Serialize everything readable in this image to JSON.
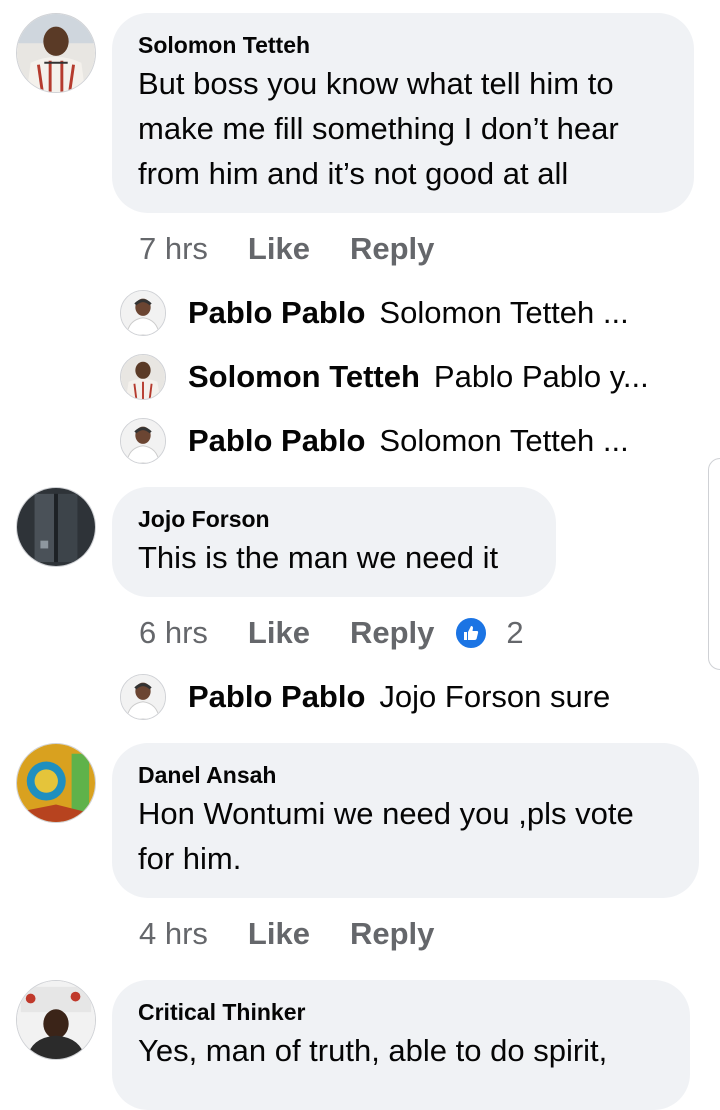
{
  "colors": {
    "bubble": "#f0f2f5",
    "meta_text": "#65676b",
    "like_badge": "#1b74e4"
  },
  "comments": [
    {
      "author": "Solomon Tetteh",
      "text": "But boss you know what tell him to\nmake me fill something I don’t hear\nfrom him and it’s not good at all",
      "time": "7 hrs",
      "like_label": "Like",
      "reply_label": "Reply",
      "replies": [
        {
          "author": "Pablo Pablo",
          "text": "Solomon Tetteh ..."
        },
        {
          "author": "Solomon Tetteh",
          "text": "Pablo Pablo y..."
        },
        {
          "author": "Pablo Pablo",
          "text": "Solomon Tetteh ..."
        }
      ]
    },
    {
      "author": "Jojo Forson",
      "text": "This is the man we need it",
      "time": "6 hrs",
      "like_label": "Like",
      "reply_label": "Reply",
      "reaction_icon": "thumbs-up-icon",
      "reaction_count": "2",
      "replies": [
        {
          "author": "Pablo Pablo",
          "text": "Jojo Forson sure"
        }
      ]
    },
    {
      "author": "Danel Ansah",
      "text": "Hon Wontumi we need you ,pls vote\nfor him.",
      "time": "4 hrs",
      "like_label": "Like",
      "reply_label": "Reply"
    },
    {
      "author": "Critical Thinker",
      "text": "Yes, man of truth, able to do spirit,"
    }
  ]
}
